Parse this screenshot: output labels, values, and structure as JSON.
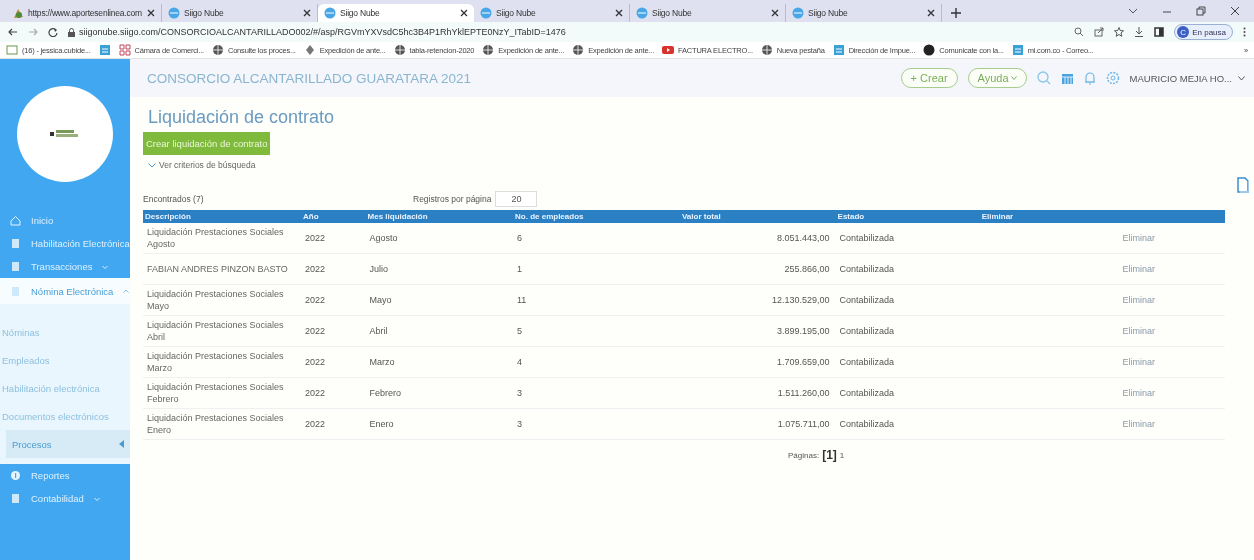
{
  "browser": {
    "tabs": [
      {
        "title": "https://www.aportesenlinea.com",
        "selected": false
      },
      {
        "title": "Siigo Nube",
        "selected": false
      },
      {
        "title": "Siigo Nube",
        "selected": true
      },
      {
        "title": "Siigo Nube",
        "selected": false
      },
      {
        "title": "Siigo Nube",
        "selected": false
      },
      {
        "title": "Siigo Nube",
        "selected": false
      }
    ],
    "url": "siigonube.siigo.com/CONSORCIOALCANTARILLADO002/#/asp/RGVmYXVsdC5hc3B4P1RhYklEPTE0NzY_ITabID=1476",
    "profile": {
      "initial": "C",
      "label": "En pausa"
    },
    "bookmarks": [
      {
        "label": "(16) - jessica.cubide..."
      },
      {
        "label": "Cámara de Comerci..."
      },
      {
        "label": "Consulte los proces..."
      },
      {
        "label": "Expedición de ante..."
      },
      {
        "label": "tabla-retencion-2020"
      },
      {
        "label": "Expedición de ante..."
      },
      {
        "label": "Expedición de ante..."
      },
      {
        "label": "FACTURA ELECTRO..."
      },
      {
        "label": "Nueva pestaña"
      },
      {
        "label": "Dirección de Impue..."
      },
      {
        "label": "Comunicate con la..."
      },
      {
        "label": "mi.com.co - Correo..."
      }
    ],
    "more": "»"
  },
  "sidebar": {
    "items": [
      {
        "label": "Inicio",
        "kind": "menu",
        "selected": false
      },
      {
        "label": "Habilitación Electrónica",
        "kind": "menu",
        "selected": false
      },
      {
        "label": "Transacciones",
        "kind": "parent",
        "expanded": false,
        "selected": false
      },
      {
        "label": "Nómina Electrónica",
        "kind": "parent",
        "expanded": true,
        "selected": false
      },
      {
        "label": "Nóminas",
        "kind": "sub",
        "selected": false
      },
      {
        "label": "Empleados",
        "kind": "sub",
        "selected": false
      },
      {
        "label": "Habilitación electrónica",
        "kind": "sub",
        "selected": false
      },
      {
        "label": "Documentos electrónicos",
        "kind": "sub",
        "selected": false
      },
      {
        "label": "Procesos",
        "kind": "sub",
        "selected": true
      },
      {
        "label": "Reportes",
        "kind": "menu",
        "selected": false
      },
      {
        "label": "Contabilidad",
        "kind": "parent",
        "expanded": false,
        "selected": false
      }
    ]
  },
  "header": {
    "company": "CONSORCIO ALCANTARILLADO GUARATARA 2021",
    "create": "+ Crear",
    "help": "Ayuda",
    "user": "MAURICIO MEJIA HO..."
  },
  "page": {
    "title": "Liquidación de contrato",
    "create_button": "Crear liquidación de contrato",
    "search_toggle": "Ver criterios de búsqueda",
    "found": "Encontrados (7)",
    "per_page_label": "Registros por página",
    "per_page": "20"
  },
  "table": {
    "columns": [
      "Descripción",
      "Año",
      "Mes liquidación",
      "No. de empleados",
      "Valor total",
      "Estado",
      "Eliminar"
    ],
    "rows": [
      [
        "Liquidación Prestaciones Sociales Agosto",
        "2022",
        "Agosto",
        "6",
        "8.051.443,00",
        "Contabilizada",
        "Eliminar"
      ],
      [
        "FABIAN ANDRES PINZON BASTO",
        "2022",
        "Julio",
        "1",
        "255.866,00",
        "Contabilizada",
        "Eliminar"
      ],
      [
        "Liquidación Prestaciones Sociales Mayo",
        "2022",
        "Mayo",
        "11",
        "12.130.529,00",
        "Contabilizada",
        "Eliminar"
      ],
      [
        "Liquidación Prestaciones Sociales Abril",
        "2022",
        "Abril",
        "5",
        "3.899.195,00",
        "Contabilizada",
        "Eliminar"
      ],
      [
        "Liquidación Prestaciones Sociales Marzo",
        "2022",
        "Marzo",
        "4",
        "1.709.659,00",
        "Contabilizada",
        "Eliminar"
      ],
      [
        "Liquidación Prestaciones Sociales Febrero",
        "2022",
        "Febrero",
        "3",
        "1.511.260,00",
        "Contabilizada",
        "Eliminar"
      ],
      [
        "Liquidación Prestaciones Sociales Enero",
        "2022",
        "Enero",
        "3",
        "1.075.711,00",
        "Contabilizada",
        "Eliminar"
      ]
    ]
  },
  "pager": {
    "label": "Páginas:",
    "current": "[1]",
    "total": "1"
  }
}
